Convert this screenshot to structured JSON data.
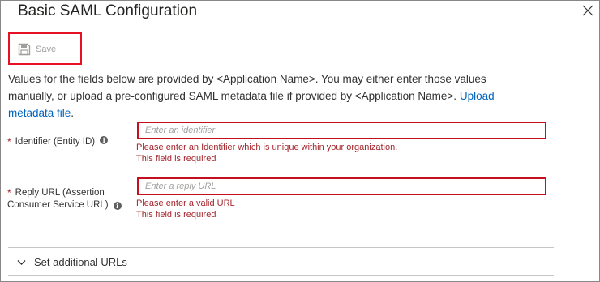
{
  "panel": {
    "title": "Basic SAML Configuration"
  },
  "toolbar": {
    "save_label": "Save"
  },
  "description": {
    "text_line1": "Values for the fields below are provided by <Application Name>. You may either enter those values",
    "text_line2": "manually, or upload a pre-configured SAML metadata file if provided by <Application Name>.",
    "link_part1": "Upload",
    "link_part2": "metadata file",
    "period": "."
  },
  "fields": {
    "identifier": {
      "required_mark": "*",
      "label": "Identifier (Entity ID)",
      "placeholder": "Enter an identifier",
      "value": "",
      "error1": "Please enter an Identifier which is unique within your organization.",
      "error2": "This field is required"
    },
    "reply_url": {
      "required_mark": "*",
      "label_line1": "Reply URL (Assertion",
      "label_line2": "Consumer Service URL)",
      "placeholder": "Enter a reply URL",
      "value": "",
      "error1": "Please enter a valid URL",
      "error2": "This field is required"
    }
  },
  "expander": {
    "label": "Set additional URLs",
    "state": "collapsed"
  },
  "colors": {
    "error": "#a4262c",
    "link": "#0064bf",
    "highlight": "#e81123",
    "separator_dashed": "#54a9d6"
  },
  "icons": {
    "close": "close-icon",
    "save": "floppy-disk-icon",
    "info": "info-icon",
    "expander": "chevron-down-icon"
  }
}
